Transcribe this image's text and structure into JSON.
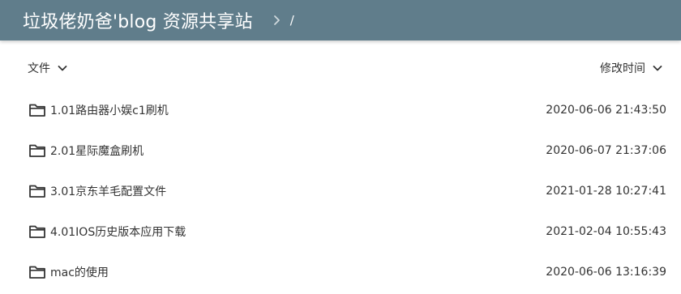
{
  "header": {
    "site_title": "垃圾佬奶爸'blog 资源共享站",
    "breadcrumb_root": "/"
  },
  "toolbar": {
    "name_sort_label": "文件",
    "time_sort_label": "修改时间"
  },
  "colors": {
    "appbar": "#607d8b",
    "text": "#333333"
  },
  "files": [
    {
      "name": "1.01路由器小娱c1刷机",
      "modified": "2020-06-06 21:43:50",
      "icon": "folder-icon"
    },
    {
      "name": "2.01星际魔盒刷机",
      "modified": "2020-06-07 21:37:06",
      "icon": "folder-icon"
    },
    {
      "name": "3.01京东羊毛配置文件",
      "modified": "2021-01-28 10:27:41",
      "icon": "folder-icon"
    },
    {
      "name": "4.01IOS历史版本应用下载",
      "modified": "2021-02-04 10:55:43",
      "icon": "folder-icon"
    },
    {
      "name": "mac的使用",
      "modified": "2020-06-06 13:16:39",
      "icon": "folder-icon"
    }
  ]
}
